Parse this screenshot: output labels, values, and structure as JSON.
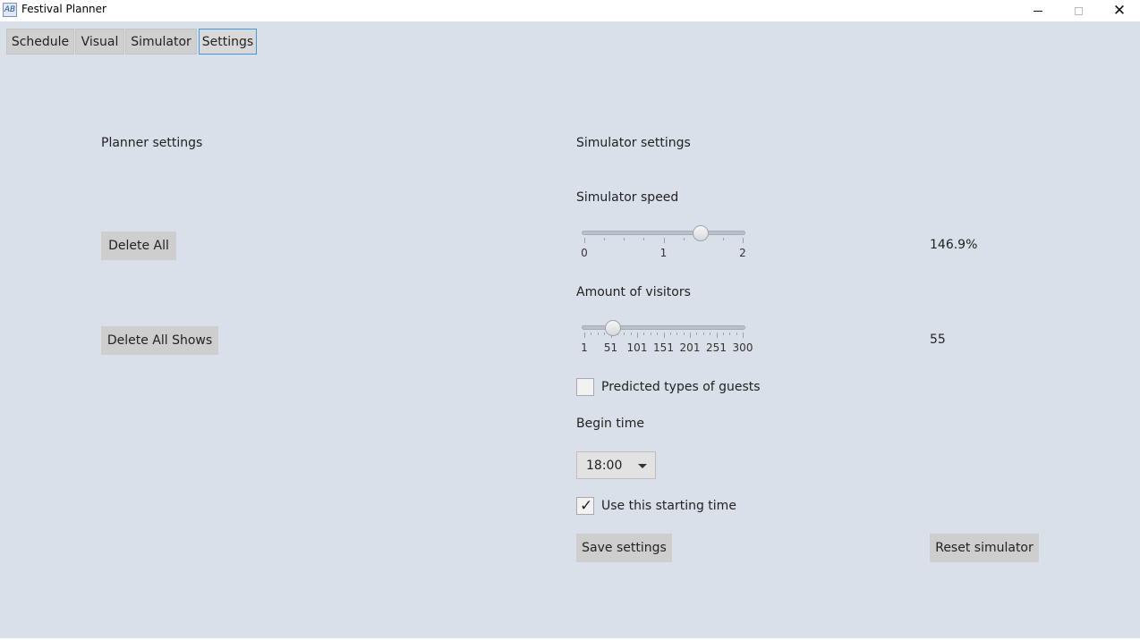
{
  "window": {
    "title": "Festival Planner",
    "icon_label": "AB"
  },
  "tabs": [
    {
      "label": "Schedule"
    },
    {
      "label": "Visual"
    },
    {
      "label": "Simulator"
    },
    {
      "label": "Settings"
    }
  ],
  "selected_tab": "Settings",
  "planner": {
    "heading": "Planner settings",
    "delete_all_label": "Delete All",
    "delete_all_shows_label": "Delete All Shows"
  },
  "simulator": {
    "heading": "Simulator settings",
    "speed": {
      "label": "Simulator speed",
      "min": 0,
      "max": 2,
      "value": 1.469,
      "tick_labels": [
        "0",
        "1",
        "2"
      ],
      "value_text": "146.9%"
    },
    "visitors": {
      "label": "Amount of visitors",
      "min": 1,
      "max": 300,
      "value": 55,
      "tick_labels": [
        "1",
        "51",
        "101",
        "151",
        "201",
        "251",
        "300"
      ],
      "value_text": "55"
    },
    "predicted_guests": {
      "label": "Predicted types of guests",
      "checked": false
    },
    "begin_time": {
      "label": "Begin time",
      "selected": "18:00"
    },
    "use_starting_time": {
      "label": "Use this starting time",
      "checked": true
    },
    "save_label": "Save settings",
    "reset_label": "Reset simulator"
  },
  "colors": {
    "background": "#dae0e9",
    "button": "#cecece",
    "tab_focus_border": "#3b9ae1"
  }
}
